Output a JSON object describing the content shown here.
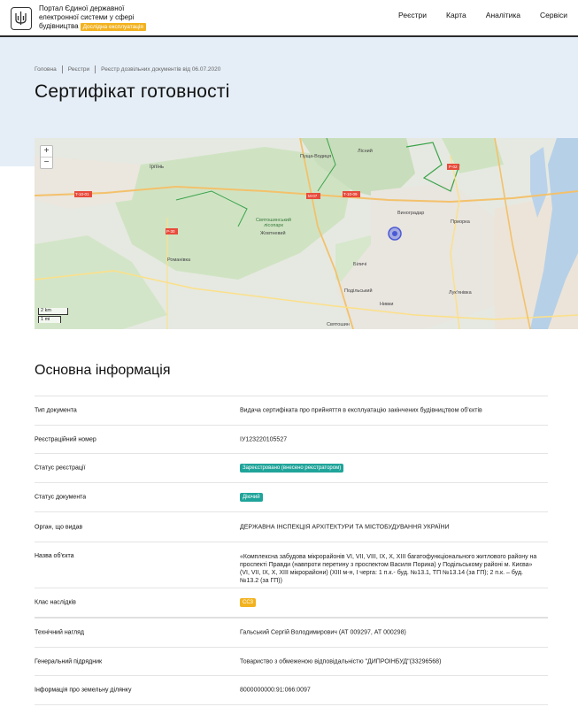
{
  "header": {
    "brand_lines": [
      "Портал Єдиної державної",
      "електронної системи у сфері",
      "будівництва"
    ],
    "beta_label": "Дослідна експлуатація",
    "nav": [
      "Реєстри",
      "Карта",
      "Аналітика",
      "Сервіси"
    ]
  },
  "breadcrumbs": [
    "Головна",
    "Реєстри",
    "Реєстр дозвільних документів від 06.07.2020"
  ],
  "page_title": "Сертифікат готовності",
  "map": {
    "zoom_in": "+",
    "zoom_out": "−",
    "scale_km": "2 km",
    "scale_mi": "1 mi",
    "labels": [
      "Ірпінь",
      "Святошинський лісопарк",
      "Жовтневий",
      "Пуща-Водиця",
      "Виноградар",
      "Подільський",
      "Лук'янівка",
      "Нивки",
      "Біличі",
      "Романівка",
      "Лісний",
      "Приорка",
      "Святошин"
    ],
    "roads": [
      "T-10-01",
      "M-07",
      "T-10-09",
      "P-30",
      "P-02"
    ]
  },
  "section_title": "Основна інформація",
  "rows": [
    {
      "key": "Тип документа",
      "value": "Видача сертифіката про прийняття в експлуатацію закінчених будівництвом об'єктів"
    },
    {
      "key": "Реєстраційний номер",
      "value": "ІУ123220105527"
    },
    {
      "key": "Статус реєстрації",
      "value": "Зареєстровано (внесено реєстратором)"
    },
    {
      "key": "Статус документа",
      "value": "Діючий"
    },
    {
      "key": "Орган, що видав",
      "value": "ДЕРЖАВНА ІНСПЕКЦІЯ АРХІТЕКТУРИ ТА МІСТОБУДУВАННЯ УКРАЇНИ"
    },
    {
      "key": "Назва об'єкта",
      "value": "«Комплексна забудова мікрорайонів VI, VII, VIII, IX, X, XIII багатофункціонального житлового району на проспекті Правди (навпроти перетину з проспектом Василя Порика) у Подільському районі м. Києва» (VI, VII, IX, X, XIII мікрорайони) (XIII м-н, І черга: 1 п.к.- буд. №13.1, ТП №13.14 (за ГП); 2 п.к. – буд. №13.2 (за ГП))"
    },
    {
      "key": "Клас наслідків",
      "value": "СС3"
    },
    {
      "key": "Технічний нагляд",
      "value": "Гальський Сергій Володимирович (АТ 009297, АТ 000298)"
    },
    {
      "key": "Генеральний підрядник",
      "value": "Товариство з обмеженою відповідальністю \"ДИПРОІНБУД\"(33296568)"
    },
    {
      "key": "Інформація про земельну ділянку",
      "value": "8000000000:91:066:0097"
    }
  ]
}
